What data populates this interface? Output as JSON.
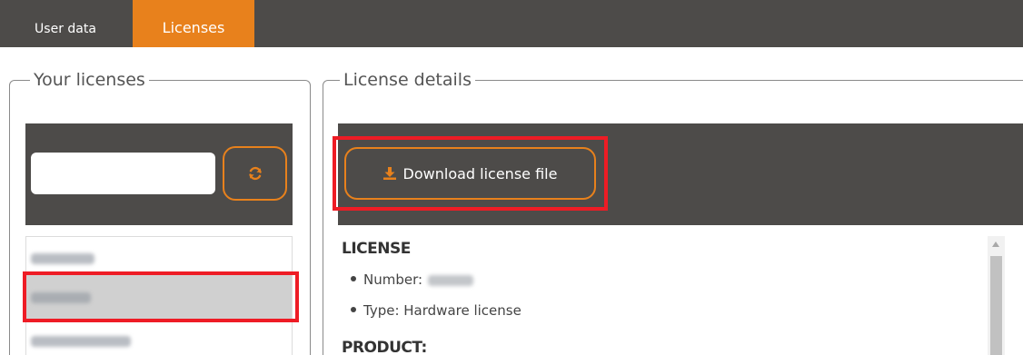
{
  "tabs": [
    {
      "label": "User data",
      "active": false
    },
    {
      "label": "Licenses",
      "active": true
    }
  ],
  "left_panel": {
    "legend": "Your licenses",
    "search": {
      "value": "",
      "placeholder": ""
    },
    "refresh_icon": "refresh-icon"
  },
  "right_panel": {
    "legend": "License details",
    "download_label": "Download license file",
    "download_icon": "download-icon",
    "license_section": "LICENSE",
    "number_label": "Number:",
    "type_label": "Type: Hardware license",
    "product_section": "PRODUCT:"
  },
  "colors": {
    "accent": "#e8811c",
    "dark_bar": "#4d4b49",
    "highlight": "#ee1c25",
    "selected_row": "#d0d0d0"
  }
}
